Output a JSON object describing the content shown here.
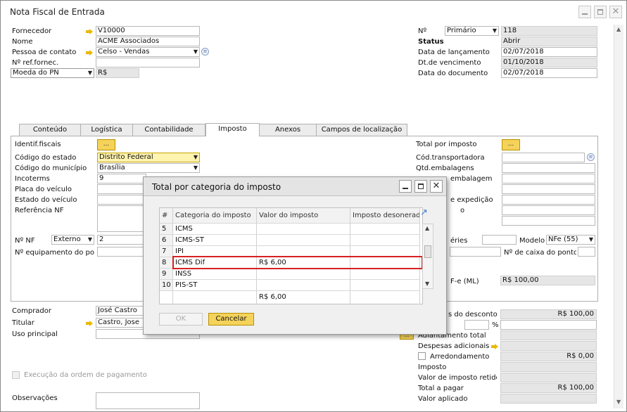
{
  "window": {
    "title": "Nota Fiscal de Entrada"
  },
  "header_left": {
    "fornecedor_label": "Fornecedor",
    "fornecedor_value": "V10000",
    "nome_label": "Nome",
    "nome_value": "ACME Associados",
    "contato_label": "Pessoa de contato",
    "contato_value": "Celso - Vendas",
    "ref_label": "Nº ref.fornec.",
    "ref_value": "",
    "moeda_label": "Moeda do PN",
    "moeda_value": "R$"
  },
  "header_right": {
    "numero_label": "Nº",
    "serie_value": "Primário",
    "numero_value": "118",
    "status_label": "Status",
    "status_value": "Abrir",
    "lancamento_label": "Data de lançamento",
    "lancamento_value": "02/07/2018",
    "vencimento_label": "Dt.de vencimento",
    "vencimento_value": "01/10/2018",
    "documento_label": "Data do documento",
    "documento_value": "02/07/2018"
  },
  "tabs": [
    "Conteúdo",
    "Logística",
    "Contabilidade",
    "Imposto",
    "Anexos",
    "Campos de localização"
  ],
  "imposto_tab": {
    "identif_label": "Identif.fiscais",
    "ellipsis": "...",
    "codestado_label": "Código do estado",
    "codestado_value": "Distrito Federal",
    "codmunicipio_label": "Código do município",
    "codmunicipio_value": "Brasília",
    "incoterms_label": "Incoterms",
    "incoterms_value": "9",
    "placa_label": "Placa do veículo",
    "estado_veiculo_label": "Estado do veículo",
    "referencia_nf_label": "Referência NF",
    "nf_label": "Nº NF",
    "nf_type_value": "Externo",
    "nf_value": "2",
    "equip_label": "Nº equipamento do ponto",
    "total_imposto_label": "Total por imposto",
    "transportadora_label": "Cód.transportadora",
    "qtd_emb_label": "Qtd.embalagens",
    "emb_label": "embalagem",
    "expedicao_label": "e expedição",
    "o_label": "o",
    "series_label": "éries",
    "modelo_label": "Modelo",
    "modelo_value": "NFe (55)",
    "caixa_label": "Nº de caixa do ponto d",
    "nfe_label": "F-e (ML)",
    "nfe_value": "R$ 100,00"
  },
  "footer_left": {
    "comprador_label": "Comprador",
    "comprador_value": "José Castro",
    "titular_label": "Titular",
    "titular_value": "Castro, Jose",
    "uso_label": "Uso principal",
    "execucao_label": "Execução da ordem de pagamento",
    "obs_label": "Observações"
  },
  "footer_right": {
    "desconto_label": "s do desconto",
    "desconto_value": "R$ 100,00",
    "percent": "%",
    "adiantamento_label": "Adiantamento total",
    "despesas_label": "Despesas adicionais",
    "arredondamento_label": "Arredondamento",
    "arredondamento_value": "R$ 0,00",
    "imposto_label": "Imposto",
    "retido_label": "Valor de imposto retido",
    "total_label": "Total a pagar",
    "total_value": "R$ 100,00",
    "aplicado_label": "Valor aplicado"
  },
  "modal": {
    "title": "Total por categoria do imposto",
    "columns": [
      "#",
      "Categoria do imposto",
      "Valor do imposto",
      "Imposto desonerado"
    ],
    "rows": [
      {
        "num": "5",
        "cat": "ICMS",
        "val": "",
        "des": ""
      },
      {
        "num": "6",
        "cat": "ICMS-ST",
        "val": "",
        "des": ""
      },
      {
        "num": "7",
        "cat": "IPI",
        "val": "",
        "des": ""
      },
      {
        "num": "8",
        "cat": "ICMS Dif",
        "val": "R$ 6,00",
        "des": ""
      },
      {
        "num": "9",
        "cat": "INSS",
        "val": "",
        "des": ""
      },
      {
        "num": "10",
        "cat": "PIS-ST",
        "val": "",
        "des": ""
      }
    ],
    "total_value": "R$ 6,00",
    "ok_label": "OK",
    "cancel_label": "Cancelar",
    "highlight_color": "#d62020"
  }
}
